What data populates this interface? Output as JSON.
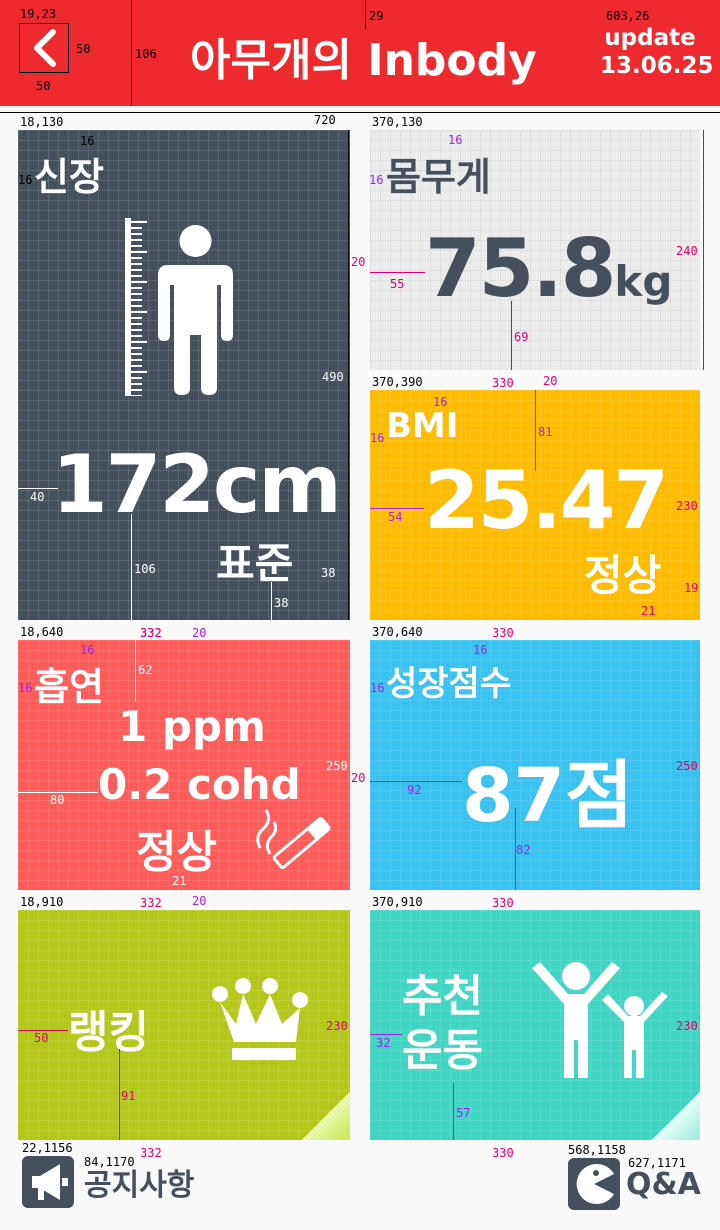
{
  "header": {
    "title": "아무개의 Inbody",
    "update_label": "update",
    "update_date": "13.06.25"
  },
  "tiles": {
    "height": {
      "label": "신장",
      "value": "172cm",
      "status": "표준"
    },
    "weight": {
      "label": "몸무게",
      "value": "75.8",
      "unit": "kg"
    },
    "bmi": {
      "label": "BMI",
      "value": "25.47",
      "status": "정상"
    },
    "smoking": {
      "label": "흡연",
      "ppm": "1 ppm",
      "cohd": "0.2 cohd",
      "status": "정상"
    },
    "growth": {
      "label": "성장점수",
      "value": "87점"
    },
    "ranking": {
      "label": "랭킹"
    },
    "exercise": {
      "label_line1": "추천",
      "label_line2": "운동"
    }
  },
  "footer": {
    "notice_label": "공지사항",
    "qa_label": "Q&A"
  },
  "annotations": {
    "back_origin": "19,23",
    "back_w": "50",
    "back_h": "50",
    "header_h": "106",
    "title_top": "29",
    "update_origin": "603,26",
    "screen_w": "720",
    "height_origin": "18,130",
    "height_pad_x": "16",
    "height_pad_y": "16",
    "height_h": "490",
    "height_val_left": "40",
    "height_val_bottom": "106",
    "height_status_right": "38",
    "height_status_bottom": "38",
    "height_w": "332",
    "gap1": "20",
    "weight_origin": "370,130",
    "weight_pad_x": "16",
    "weight_pad_y": "16",
    "weight_gap": "20",
    "weight_val_left": "55",
    "weight_h": "240",
    "weight_val_bottom": "69",
    "weight_w": "330",
    "weight_gap_b": "20",
    "bmi_origin": "370,390",
    "bmi_pad_x": "16",
    "bmi_pad_y": "16",
    "bmi_val_top": "81",
    "bmi_val_left": "54",
    "bmi_h": "230",
    "bmi_status_right": "19",
    "bmi_status_bottom": "21",
    "smoke_origin": "18,640",
    "smoke_w": "332",
    "smoke_gap": "20",
    "smoke_pad_x": "16",
    "smoke_pad_y": "16",
    "smoke_val_top": "62",
    "smoke_val_left": "80",
    "smoke_h": "250",
    "smoke_status_bottom": "21",
    "smoke_gap_b": "20",
    "smoke_w2": "332",
    "growth_origin": "370,640",
    "growth_w": "330",
    "growth_pad_x": "16",
    "growth_pad_y": "16",
    "growth_gap": "20",
    "growth_val_left": "92",
    "growth_h": "250",
    "growth_val_bottom": "82",
    "growth_w2": "330",
    "rank_origin": "18,910",
    "rank_val_left": "50",
    "rank_val_bottom": "91",
    "rank_h": "230",
    "rank_w": "332",
    "ex_origin": "370,910",
    "ex_val_left": "32",
    "ex_val_bottom": "57",
    "ex_h": "230",
    "ex_w": "330",
    "notice_origin": "22,1156",
    "notice_text_origin": "84,1170",
    "qa_origin": "568,1158",
    "qa_text_origin": "627,1171"
  },
  "colors": {
    "header": "#ee2a2e",
    "height": "#46505c",
    "weight": "#ececec",
    "bmi": "#ffbb00",
    "smoking": "#ff5b59",
    "growth": "#38c2f2",
    "ranking": "#b4c81a",
    "exercise": "#40d6c4"
  },
  "icons": [
    "back-arrow-icon",
    "ruler-icon",
    "person-icon",
    "cigarette-icon",
    "crown-icon",
    "parent-child-icon",
    "megaphone-icon",
    "pacman-icon"
  ]
}
